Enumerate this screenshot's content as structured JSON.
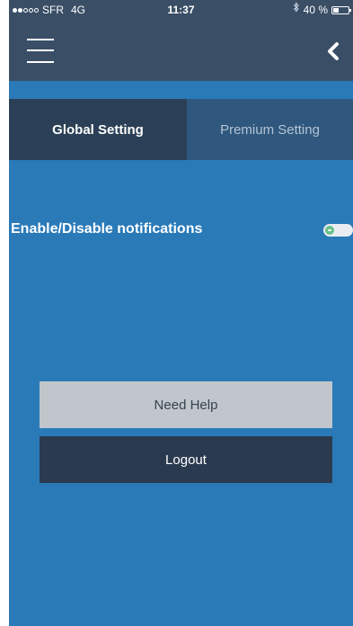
{
  "status_bar": {
    "carrier": "SFR",
    "network": "4G",
    "time": "11:37",
    "battery_text": "40 %",
    "battery_level": 0.4,
    "signal_bars_filled": 2,
    "signal_bars_total": 5
  },
  "header": {
    "menu_icon": "hamburger-menu-icon",
    "back_icon": "chevron-left-icon"
  },
  "tabs": [
    {
      "label": "Global Setting",
      "active": true
    },
    {
      "label": "Premium Setting",
      "active": false
    }
  ],
  "notifications": {
    "label": "Enable/Disable notifications",
    "enabled": true
  },
  "buttons": {
    "help_label": "Need Help",
    "logout_label": "Logout"
  },
  "colors": {
    "background": "#2a7ab8",
    "header": "#3a4e66",
    "active_tab": "#2b4056",
    "inactive_tab": "#30587e",
    "help_button": "#c0c6cb",
    "logout_button": "#2b3b4f",
    "toggle_knob": "#69c08a"
  }
}
